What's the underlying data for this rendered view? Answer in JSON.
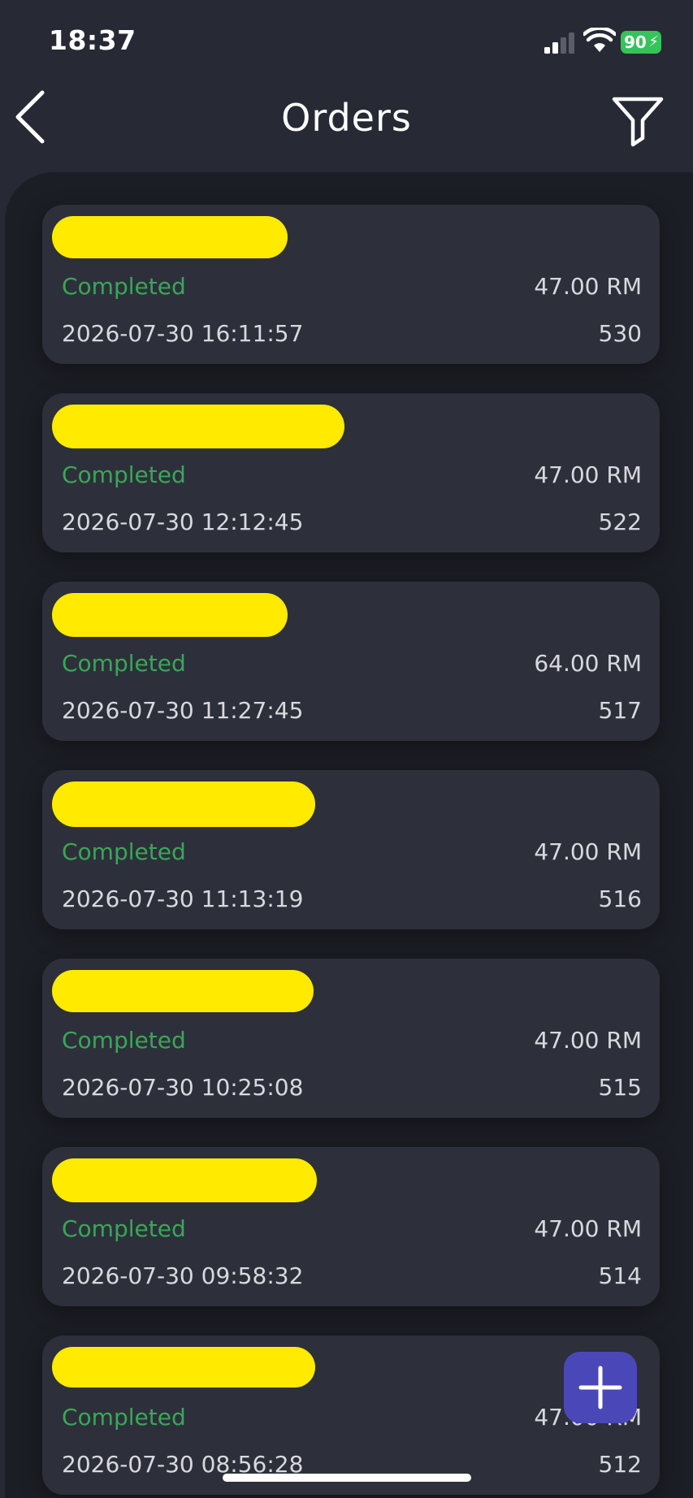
{
  "status_bar": {
    "time": "18:37",
    "battery": "90"
  },
  "nav": {
    "title": "Orders"
  },
  "orders": [
    {
      "status": "Completed",
      "amount": "47.00 RM",
      "date": "2026-07-30 16:11:57",
      "number": "530"
    },
    {
      "status": "Completed",
      "amount": "47.00 RM",
      "date": "2026-07-30 12:12:45",
      "number": "522"
    },
    {
      "status": "Completed",
      "amount": "64.00 RM",
      "date": "2026-07-30 11:27:45",
      "number": "517"
    },
    {
      "status": "Completed",
      "amount": "47.00 RM",
      "date": "2026-07-30 11:13:19",
      "number": "516"
    },
    {
      "status": "Completed",
      "amount": "47.00 RM",
      "date": "2026-07-30 10:25:08",
      "number": "515"
    },
    {
      "status": "Completed",
      "amount": "47.00 RM",
      "date": "2026-07-30 09:58:32",
      "number": "514"
    },
    {
      "status": "Completed",
      "amount": "47.00 RM",
      "date": "2026-07-30 08:56:28",
      "number": "512"
    }
  ],
  "icons": {
    "back": "chevron-left-icon",
    "filter": "funnel-icon",
    "add": "plus-icon"
  },
  "colors": {
    "status_completed": "#3aa658",
    "fab": "#4a48b8",
    "redaction": "#ffea00"
  }
}
